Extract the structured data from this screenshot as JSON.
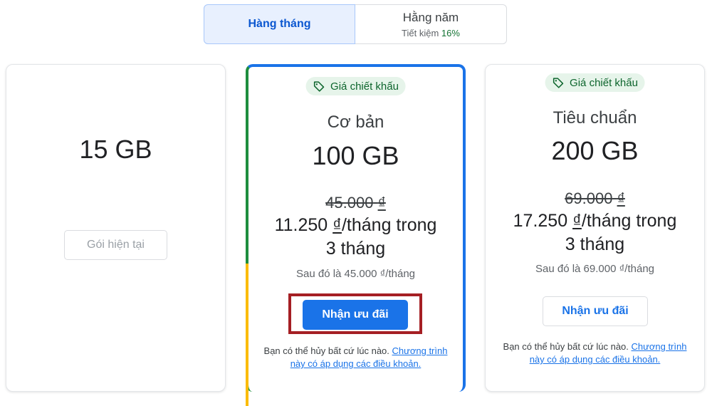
{
  "toggle": {
    "monthly_label": "Hàng tháng",
    "yearly_label": "Hằng năm",
    "yearly_sub": "Tiết kiệm",
    "yearly_pct": "16%"
  },
  "plans": [
    {
      "storage": "15 GB",
      "button_label": "Gói hiện tại"
    },
    {
      "badge": "Giá chiết khấu",
      "name": "Cơ bản",
      "storage": "100 GB",
      "old_price_num": "45.000",
      "currency": "₫",
      "promo_num": "11.250",
      "promo_suffix": "/tháng trong",
      "promo_line2": "3 tháng",
      "after_text": "Sau đó là 45.000 ₫/tháng",
      "button_label": "Nhận ưu đãi",
      "note_text": "Bạn có thể hủy bất cứ lúc nào.",
      "note_link": "Chương trình này có áp dụng các điều khoản."
    },
    {
      "badge": "Giá chiết khấu",
      "name": "Tiêu chuẩn",
      "storage": "200 GB",
      "old_price_num": "69.000",
      "currency": "₫",
      "promo_num": "17.250",
      "promo_suffix": "/tháng trong",
      "promo_line2": "3 tháng",
      "after_text": "Sau đó là 69.000 ₫/tháng",
      "button_label": "Nhận ưu đãi",
      "note_text": "Bạn có thể hủy bất cứ lúc nào.",
      "note_link": "Chương trình này có áp dụng các điều khoản."
    }
  ],
  "colors": {
    "accent": "#1a73e8",
    "badge_bg": "#e6f4ea",
    "highlight": "#a51f24"
  },
  "icons": {
    "badge": "tag-icon"
  }
}
